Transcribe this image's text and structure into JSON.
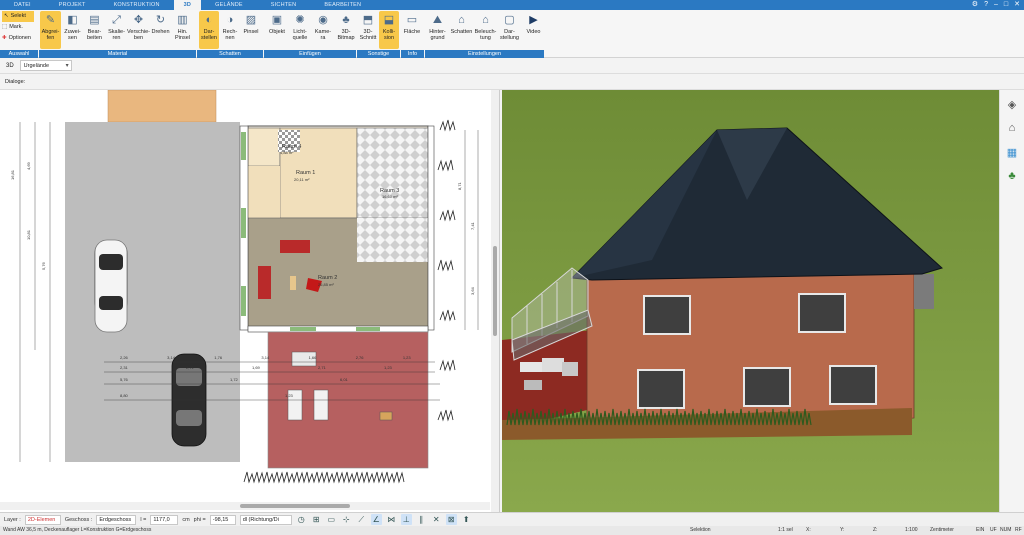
{
  "tabs": [
    "DATEI",
    "PROJEKT",
    "KONSTRUKTION",
    "3D",
    "GELÄNDE",
    "SICHTEN",
    "BEARBEITEN"
  ],
  "left_tools": {
    "selekt": "Selekt",
    "mark": "Mark.",
    "optionen": "Optionen",
    "group": "Auswahl"
  },
  "ribbon": {
    "material": [
      {
        "label": "Abgrei-\nfen",
        "icon": "eyedropper-icon"
      },
      {
        "label": "Zuwei-\nsen",
        "icon": "paint-bucket-icon"
      },
      {
        "label": "Bear-\nbeiten",
        "icon": "edit-material-icon"
      },
      {
        "label": "Skalie-\nren",
        "icon": "scale-icon"
      },
      {
        "label": "Verschie-\nben",
        "icon": "move-icon"
      },
      {
        "label": "Drehen",
        "icon": "rotate-icon"
      },
      {
        "label": "Hin.\nPinsel",
        "icon": "brush-icon"
      }
    ],
    "schatten": [
      {
        "label": "Dar-\nstellen",
        "icon": "shadow-display-icon"
      },
      {
        "label": "Rech-\nnen",
        "icon": "calculate-icon"
      },
      {
        "label": "Pinsel",
        "icon": "shadow-brush-icon"
      }
    ],
    "einfuegen": [
      {
        "label": "Objekt",
        "icon": "object-icon"
      },
      {
        "label": "Licht-\nquelle",
        "icon": "light-icon"
      },
      {
        "label": "Kame-\nra",
        "icon": "camera-icon"
      },
      {
        "label": "3D-\nBitmap",
        "icon": "tree-icon"
      }
    ],
    "sonstige": [
      {
        "label": "3D-\nSchnitt",
        "icon": "section-icon"
      },
      {
        "label": "Kolli-\nsion",
        "icon": "collision-icon"
      }
    ],
    "info": [
      {
        "label": "Fläche",
        "icon": "area-icon"
      }
    ],
    "einstellungen": [
      {
        "label": "Hinter-\ngrund",
        "icon": "background-icon"
      },
      {
        "label": "Schatten",
        "icon": "house-shadow-icon"
      },
      {
        "label": "Beleuch-\ntung",
        "icon": "lighting-icon"
      },
      {
        "label": "Dar-\nstellung",
        "icon": "display-icon"
      },
      {
        "label": "Video",
        "icon": "video-icon"
      }
    ],
    "groups": {
      "auswahl": "Auswahl",
      "material": "Material",
      "schatten": "Schatten",
      "einfuegen": "Einfügen",
      "sonstige": "Sonstige",
      "info": "Info",
      "einstellungen": "Einstellungen"
    }
  },
  "viewbar": {
    "mode": "3D",
    "terrain": "Urgelände"
  },
  "dialoge": "Dialoge:",
  "rooms": {
    "r1": "Raum 1",
    "r1_area": "20,11 m²",
    "r2": "Raum 2",
    "r2_area": "26,85 m²",
    "r3": "Raum 3",
    "r3_area": "16,60 m²",
    "r4": "Raum 4",
    "r4_area": "4,88 m²"
  },
  "dimensions": {
    "left": [
      "16,81",
      "4,69",
      "10,81",
      "5,76"
    ],
    "right": [
      "8,71",
      "7,41",
      "3,64"
    ],
    "row1": [
      "2,26",
      "3,14",
      "1,76",
      "3,14",
      "1,66",
      "2,76",
      "1,23"
    ],
    "row2": [
      "2,31",
      "2,71",
      "1,69",
      "2,71",
      "1,23"
    ],
    "row3": [
      "5,76",
      "1,72",
      "6,01"
    ],
    "row4": [
      "8,80",
      "1,23"
    ]
  },
  "bottom": {
    "layer_label": "Layer :",
    "layer_value": "2D-Elemen",
    "geschoss_label": "Geschoss :",
    "geschoss_value": "Erdgeschoss",
    "l_label": "l =",
    "l_value": "1177,0",
    "l_unit": "cm",
    "phi_label": "phi =",
    "phi_value": "-98,15",
    "direction": "dl (Richtung/Di"
  },
  "status": {
    "left": "Wand AW 36,5 m, Deckenauflager L=Konstruktion G=Erdgeschoss",
    "selektion": "Selektion",
    "scale_sel": "1:1 sel",
    "x": "X:",
    "y": "Y:",
    "z": "Z:",
    "zoom": "1:100",
    "unit": "Zentimeter",
    "ein": "EIN",
    "uf": "UF",
    "num": "NUM",
    "rf": "RF"
  },
  "colors": {
    "accent": "#2b79c2",
    "active": "#f8c84a",
    "grass": "#7c9b3f",
    "facade": "#b86a4c",
    "roof": "#1f2a36"
  }
}
